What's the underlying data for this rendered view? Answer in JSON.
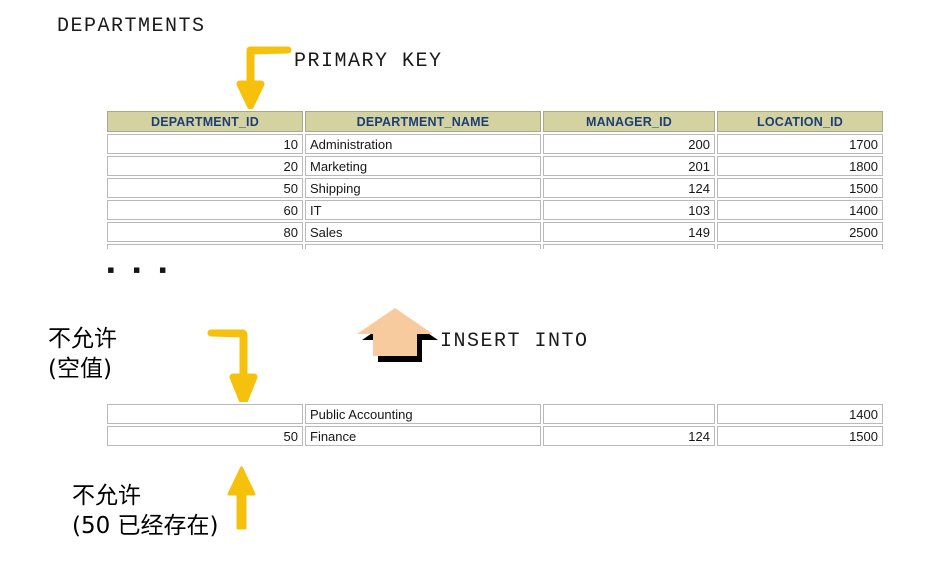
{
  "diagram": {
    "title": "DEPARTMENTS",
    "annotations": {
      "primary_key": "PRIMARY KEY",
      "insert_into": "INSERT INTO",
      "not_allowed_null_line1": "不允许",
      "not_allowed_null_line2": "(空值)",
      "not_allowed_dup_line1": "不允许",
      "not_allowed_dup_line2": "(50 已经存在)"
    },
    "ellipsis": "▪ ▪ ▪",
    "colors": {
      "header_fill": "#d5d2a2",
      "header_text": "#1b3f73",
      "arrow_yellow": "#f5c10d",
      "insert_arrow_fill": "#f7cb9e",
      "insert_arrow_shadow": "#000000",
      "cell_border": "#b9b9b9"
    }
  },
  "chart_data": {
    "type": "table",
    "title": "DEPARTMENTS",
    "columns": [
      "DEPARTMENT_ID",
      "DEPARTMENT_NAME",
      "MANAGER_ID",
      "LOCATION_ID"
    ],
    "existing_rows": [
      [
        "10",
        "Administration",
        "200",
        "1700"
      ],
      [
        "20",
        "Marketing",
        "201",
        "1800"
      ],
      [
        "50",
        "Shipping",
        "124",
        "1500"
      ],
      [
        "60",
        "IT",
        "103",
        "1400"
      ],
      [
        "80",
        "Sales",
        "149",
        "2500"
      ]
    ],
    "inserted_rows": [
      [
        "",
        "Public Accounting",
        "",
        "1400"
      ],
      [
        "50",
        "Finance",
        "124",
        "1500"
      ]
    ],
    "notes": [
      "PRIMARY KEY on DEPARTMENT_ID",
      "不允许 (空值) — null primary key rejected",
      "不允许 (50 已经存在) — duplicate primary key rejected"
    ]
  },
  "tables": {
    "departments": {
      "headers": [
        "DEPARTMENT_ID",
        "DEPARTMENT_NAME",
        "MANAGER_ID",
        "LOCATION_ID"
      ],
      "rows": [
        {
          "department_id": "10",
          "department_name": "Administration",
          "manager_id": "200",
          "location_id": "1700"
        },
        {
          "department_id": "20",
          "department_name": "Marketing",
          "manager_id": "201",
          "location_id": "1800"
        },
        {
          "department_id": "50",
          "department_name": "Shipping",
          "manager_id": "124",
          "location_id": "1500"
        },
        {
          "department_id": "60",
          "department_name": "IT",
          "manager_id": "103",
          "location_id": "1400"
        },
        {
          "department_id": "80",
          "department_name": "Sales",
          "manager_id": "149",
          "location_id": "2500"
        }
      ]
    },
    "inserts": {
      "rows": [
        {
          "department_id": "",
          "department_name": "Public Accounting",
          "manager_id": "",
          "location_id": "1400"
        },
        {
          "department_id": "50",
          "department_name": "Finance",
          "manager_id": "124",
          "location_id": "1500"
        }
      ]
    }
  }
}
